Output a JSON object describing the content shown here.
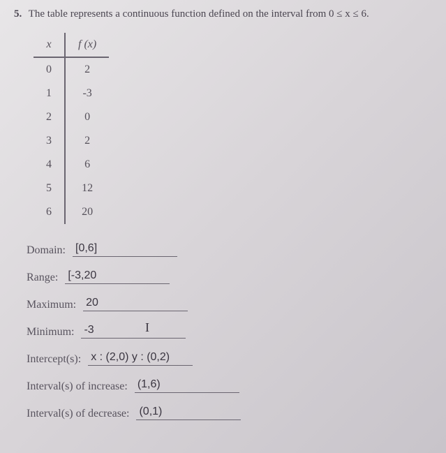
{
  "question": {
    "number": "5.",
    "text_part1": "The table represents a continuous function defined on the interval from ",
    "text_part2": "0 ≤ x ≤ 6."
  },
  "table": {
    "header_x": "x",
    "header_fx": "f (x)",
    "rows": [
      {
        "x": "0",
        "fx": "2"
      },
      {
        "x": "1",
        "fx": "-3"
      },
      {
        "x": "2",
        "fx": "0"
      },
      {
        "x": "3",
        "fx": "2"
      },
      {
        "x": "4",
        "fx": "6"
      },
      {
        "x": "5",
        "fx": "12"
      },
      {
        "x": "6",
        "fx": "20"
      }
    ]
  },
  "answers": {
    "domain_label": "Domain:",
    "domain_value": "[0,6]",
    "range_label": "Range:",
    "range_value": "[-3,20",
    "maximum_label": "Maximum:",
    "maximum_value": "20",
    "minimum_label": "Minimum:",
    "minimum_value": "-3",
    "intercepts_label": "Intercept(s):",
    "intercepts_value": "x : (2,0) y : (0,2)",
    "increase_label": "Interval(s) of increase:",
    "increase_value": "(1,6)",
    "decrease_label": "Interval(s) of decrease:",
    "decrease_value": "(0,1)"
  },
  "cursor": "I"
}
